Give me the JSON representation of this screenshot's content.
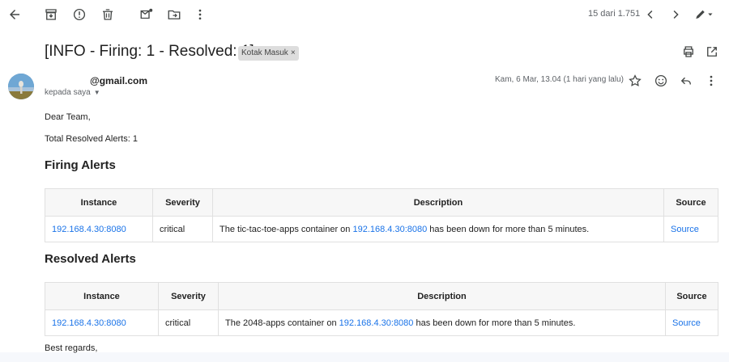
{
  "toolbar": {
    "pager": "15 dari 1.751"
  },
  "email": {
    "subject": "[INFO - Firing: 1 - Resolved: 1]",
    "label": "Kotak Masuk",
    "label_close": "×",
    "sender": "@gmail.com",
    "recipient": "kepada saya",
    "date": "Kam, 6 Mar, 13.04 (1 hari yang lalu)"
  },
  "body": {
    "greeting": "Dear Team,",
    "total_resolved": "Total Resolved Alerts: 1",
    "firing_heading": "Firing Alerts",
    "resolved_heading": "Resolved Alerts",
    "regards": "Best regards,",
    "headers": {
      "instance": "Instance",
      "severity": "Severity",
      "description": "Description",
      "source": "Source"
    },
    "firing_row": {
      "instance": "192.168.4.30:8080",
      "severity": "critical",
      "desc_pre": "The tic-tac-toe-apps container on ",
      "desc_link": "192.168.4.30:8080",
      "desc_post": " has been down for more than 5 minutes.",
      "source": "Source"
    },
    "resolved_row": {
      "instance": "192.168.4.30:8080",
      "severity": "critical",
      "desc_pre": "The 2048-apps container on ",
      "desc_link": "192.168.4.30:8080",
      "desc_post": " has been down for more than 5 minutes.",
      "source": "Source"
    }
  },
  "icons": {
    "back": "arrow-back-icon",
    "archive": "archive-icon",
    "spam": "report-spam-icon",
    "delete": "trash-icon",
    "unread": "mark-unread-icon",
    "move": "move-to-icon",
    "more": "more-vert-icon",
    "prev": "chevron-left-icon",
    "next": "chevron-right-icon",
    "edit": "pencil-icon",
    "print": "print-icon",
    "open": "open-new-window-icon",
    "star": "star-icon",
    "emoji": "emoji-icon",
    "reply": "reply-icon"
  }
}
